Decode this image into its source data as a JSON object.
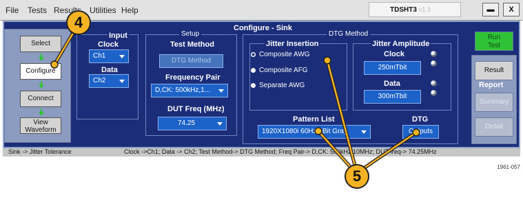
{
  "menubar": {
    "items": [
      "File",
      "Tests",
      "Results",
      "Utilities",
      "Help"
    ],
    "app_name": "TDSHT3",
    "app_suffix": "v1.3",
    "minimize_label": "▬",
    "close_label": "X"
  },
  "panel": {
    "title": "Configure - Sink"
  },
  "nav": {
    "select": "Select",
    "configure": "Configure",
    "connect": "Connect",
    "view_line1": "View",
    "view_line2": "Waveform"
  },
  "input": {
    "group_title": "Input",
    "clock_label": "Clock",
    "clock_value": "Ch1",
    "data_label": "Data",
    "data_value": "Ch2"
  },
  "setup": {
    "group_title": "Setup",
    "test_method_label": "Test Method",
    "test_method_value": "DTG Method",
    "freq_pair_label": "Frequency Pair",
    "freq_pair_value": "D,CK: 500kHz,1...",
    "dut_freq_label": "DUT Freq (MHz)",
    "dut_freq_value": "74.25"
  },
  "dtg_method": {
    "group_title": "DTG Method",
    "jitter_insertion_label": "Jitter Insertion",
    "options": [
      "Composite AWG",
      "Composite AFG",
      "Separate AWG"
    ],
    "selected_option": "Composite AWG",
    "jitter_amplitude_label": "Jitter Amplitude",
    "clock_label": "Clock",
    "clock_value": "250mTbit",
    "data_label": "Data",
    "data_value": "300mTbit",
    "pattern_list_label": "Pattern List",
    "pattern_list_value": "1920X1080i 60Hz 8Bit Gray",
    "dtg_label": "DTG",
    "outputs_label": "Outputs"
  },
  "right": {
    "run_line1": "Run",
    "run_line2": "Test",
    "result": "Result",
    "report_label": "Report",
    "summary": "Summary",
    "detail": "Detail"
  },
  "status": {
    "left": "Sink -> Jitter Tolerance",
    "right": "Clock ->Ch1; Data -> Ch2; Test Method-> DTG Method; Freq Pair-> D,CK: 500kHz,10MHz; DUT freq-> 74.25MHz"
  },
  "callouts": {
    "step4": "4",
    "step5": "5"
  },
  "figure_id": "1961-057",
  "colors": {
    "panel": "#1b2c78",
    "accent_green": "#2fc237",
    "dropdown": "#1c62c9",
    "callout": "#f5b223"
  }
}
